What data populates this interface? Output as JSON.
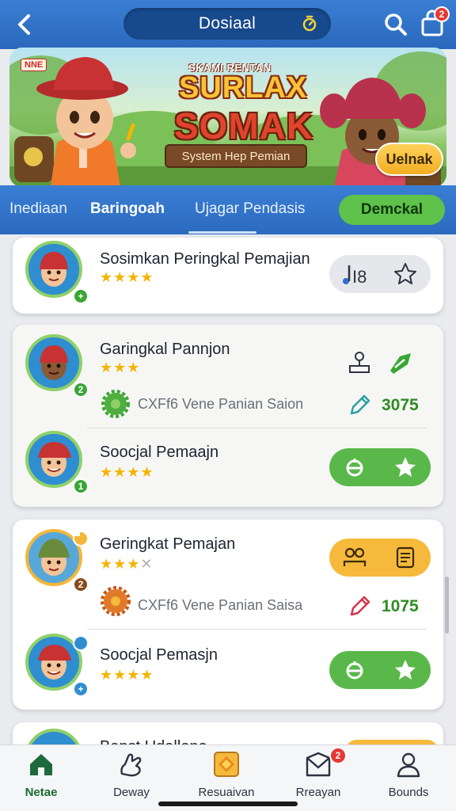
{
  "header": {
    "title": "Dosiaal",
    "cart_badge": "2"
  },
  "banner": {
    "tag": "NNE",
    "logo_small": "SKAMI RENTAN",
    "logo_line1": "SURLAX",
    "logo_line2": "SOMAK",
    "ribbon": "System Hep Pemian",
    "unlock_label": "Uelnak"
  },
  "tabs": [
    {
      "label": "Inediaan"
    },
    {
      "label": "Baringoah"
    },
    {
      "label": "Ujagar Pendasis"
    },
    {
      "label": "Demckal"
    }
  ],
  "cards": [
    {
      "rows": [
        {
          "name": "Sosimkan Peringkal Pemajian",
          "stars": "★★★★"
        }
      ],
      "action_text": "I8"
    },
    {
      "rows": [
        {
          "name": "Garingkal Pannjon",
          "stars": "★★★",
          "sub": "CXFf6 Vene Panian Saion",
          "score": "3075"
        },
        {
          "name": "Soocjal Pemaajn",
          "stars": "★★★★"
        }
      ]
    },
    {
      "rows": [
        {
          "name": "Geringkat Pemajan",
          "stars": "★★★",
          "sub": "CXFf6 Vene Panian Saisa",
          "score": "1075"
        },
        {
          "name": "Soocjal Pemasjn",
          "stars": "★★★★"
        }
      ]
    },
    {
      "rows": [
        {
          "name": "Bapst Udallone"
        }
      ]
    }
  ],
  "badges": {
    "plus": "+",
    "two": "2",
    "one": "1"
  },
  "bottom_nav": [
    {
      "label": "Netae",
      "icon": "home-icon"
    },
    {
      "label": "Deway",
      "icon": "hand-icon"
    },
    {
      "label": "Resuaivan",
      "icon": "gem-box-icon"
    },
    {
      "label": "Rreayan",
      "icon": "envelope-icon",
      "badge": "2"
    },
    {
      "label": "Bounds",
      "icon": "profile-icon"
    }
  ],
  "colors": {
    "primary_blue": "#2f74cc",
    "accent_green": "#5ab84a",
    "accent_orange": "#f6b93b",
    "score_green": "#2e8b24",
    "badge_red": "#e53935"
  }
}
